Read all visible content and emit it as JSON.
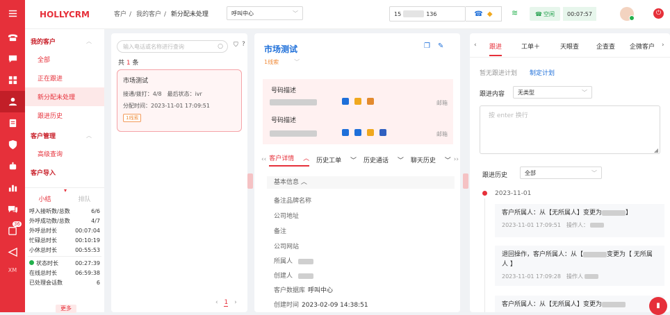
{
  "brand": "HOLLYCRM",
  "rail_icons": [
    "menu-icon",
    "phone-icon",
    "chat-icon",
    "grid-icon",
    "customer-icon",
    "clipboard-icon",
    "shield-icon",
    "robot-icon",
    "chart-icon",
    "message-icon",
    "task-icon",
    "send-icon"
  ],
  "rail_badge": "36",
  "rail_bottom": "XM",
  "breadcrumb": {
    "a": "客户",
    "sep": "/",
    "b": "我的客户",
    "c": "新分配未处理",
    "queue_value": "呼叫中心"
  },
  "topbar": {
    "phone_prefix": "15",
    "phone_suffix": "136",
    "status_label": "空闲",
    "timer": "00:07:57"
  },
  "sidenav": {
    "group1": "我的客户",
    "items1": [
      "全部",
      "正在跟进",
      "新分配未处理",
      "跟进历史"
    ],
    "group2": "客户管理",
    "items2": [
      "高级查询"
    ],
    "group3": "客户导入"
  },
  "stats": {
    "tab1": "小结",
    "tab2": "排队",
    "rows1": [
      [
        "呼入接听数/总数",
        "6/6"
      ],
      [
        "外呼成功数/总数",
        "4/7"
      ],
      [
        "外呼总时长",
        "00:07:04"
      ],
      [
        "忙碌总时长",
        "00:10:19"
      ],
      [
        "小休总时长",
        "00:55:53"
      ]
    ],
    "rows2": [
      [
        "状态时长",
        "00:27:39"
      ],
      [
        "在线总时长",
        "06:59:38"
      ],
      [
        "已处理会话数",
        "6"
      ]
    ],
    "more": "更多"
  },
  "list": {
    "search_placeholder": "输入电话或名称进行查询",
    "total_prefix": "共",
    "total_count": "1",
    "total_suffix": "条",
    "card": {
      "title": "市场测试",
      "line1": "接通/拨打：4/8　最后状态：ivr",
      "line2": "分配时间：2023-11-01 17:09:51",
      "tag": "1线索"
    },
    "page": "1"
  },
  "detail": {
    "title": "市场测试",
    "sub": "1线索",
    "num_label1": "号码描述",
    "num_label2": "号码描述",
    "email": "邮箱",
    "tabs": [
      "客户详情",
      "历史工单",
      "历史通话",
      "聊天历史"
    ],
    "section": "基本信息",
    "fields": [
      "备注品牌名称",
      "公司地址",
      "备注",
      "公司网站",
      "所属人",
      "创建人"
    ],
    "db_label": "客户数据库",
    "db_value": "呼叫中心",
    "created_label": "创建时间",
    "created_value": "2023-02-09 14:38:51"
  },
  "follow": {
    "tabs": [
      "跟进",
      "工单＋",
      "天眼查",
      "企查查",
      "企微客户"
    ],
    "no_plan": "暂无跟进计划",
    "make_plan": "制定计划",
    "content_label": "跟进内容",
    "type_value": "无类型",
    "textarea_placeholder": "按 enter 换行",
    "history_label": "跟进历史",
    "history_filter": "全部",
    "date": "2023-11-01",
    "records": [
      {
        "text": "客户所属人：从【无所属人】变更为",
        "close": "】",
        "time": "2023-11-01 17:09:51",
        "op": "操作人："
      },
      {
        "text": "退回操作，客户所属人：从【",
        "mid": "变更为【 无所属人 】",
        "time": "2023-11-01 17:09:28",
        "op": "操作人"
      },
      {
        "text": "客户所属人：从【无所属人】变更为"
      }
    ]
  }
}
